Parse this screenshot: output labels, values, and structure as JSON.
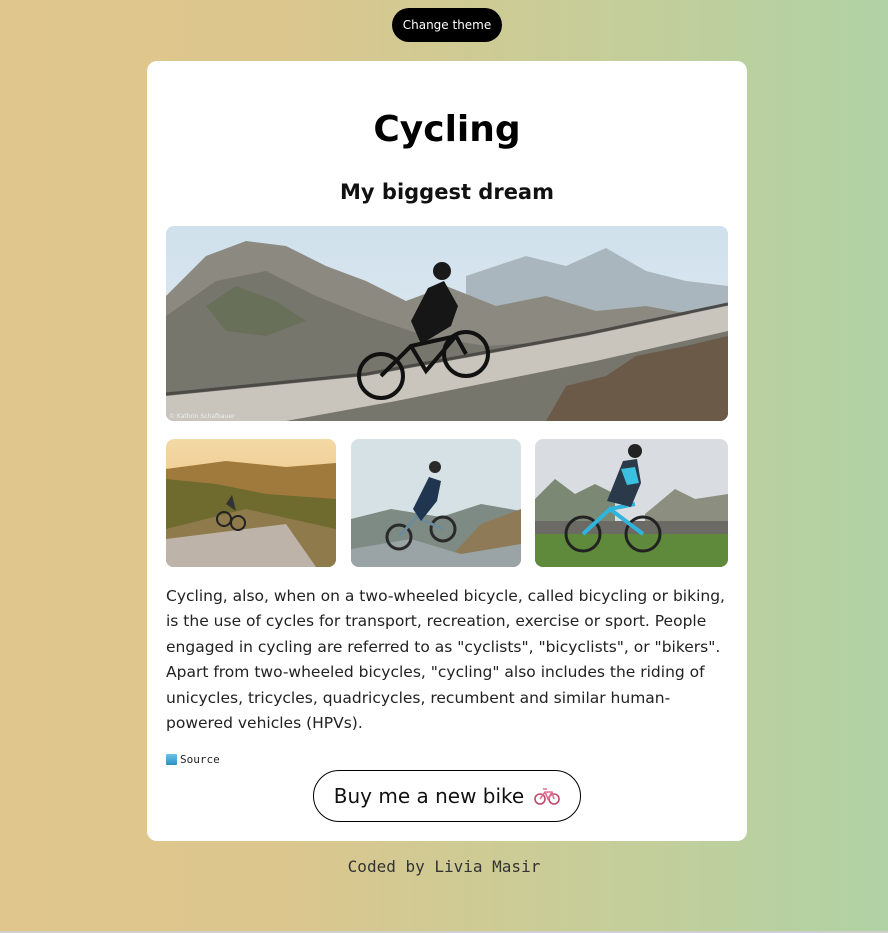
{
  "header": {
    "theme_button_label": "Change theme"
  },
  "card": {
    "title": "Cycling",
    "subtitle": "My biggest dream",
    "hero_image": {
      "alt": "Cyclist climbing a mountain road",
      "credit": "© Kathrin Schafbauer"
    },
    "thumbnails": [
      {
        "alt": "Cyclist on a road at sunset"
      },
      {
        "alt": "Cyclist descending a coastal road"
      },
      {
        "alt": "Cyclist riding a blue road bike"
      }
    ],
    "paragraph": "Cycling, also, when on a two-wheeled bicycle, called bicycling or biking, is the use of cycles for transport, recreation, exercise or sport. People engaged in cycling are referred to as \"cyclists\", \"bicyclists\", or \"bikers\". Apart from two-wheeled bicycles, \"cycling\" also includes the riding of unicycles, tricycles, quadricycles, recumbent and similar human-powered vehicles (HPVs).",
    "source_label": "Source",
    "buy_button_label": "Buy me a new bike"
  },
  "footer": {
    "text": "Coded by Livia Masir"
  },
  "colors": {
    "gradient_left": "#e0c68c",
    "gradient_right": "#b0d2a5",
    "button_dark": "#000000"
  },
  "icons": {
    "source": "book-icon",
    "buy": "bicycle-icon"
  }
}
